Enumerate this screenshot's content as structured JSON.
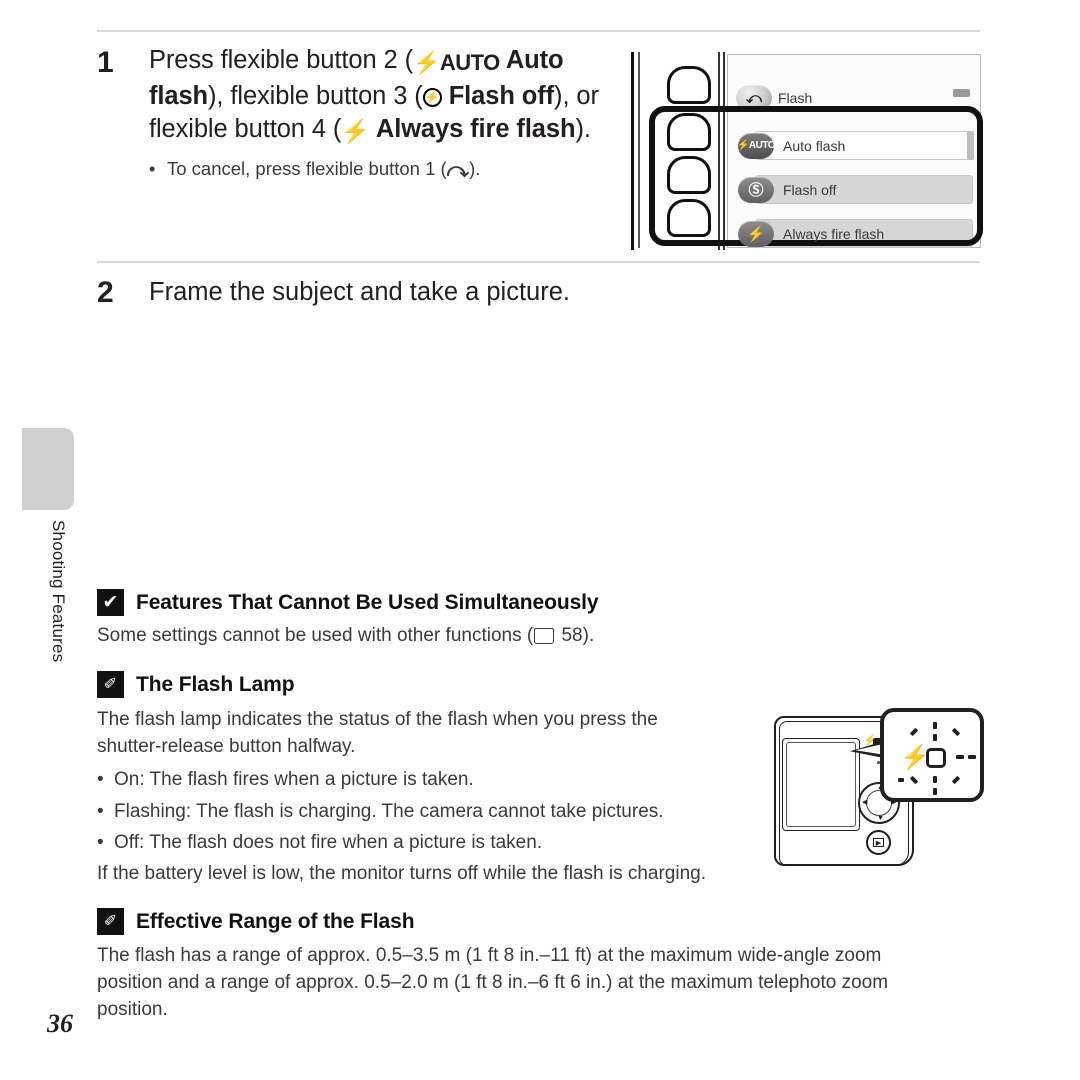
{
  "page": {
    "number": "36",
    "side_tab_label": "Shooting Features"
  },
  "steps": [
    {
      "number": "1",
      "title_parts": [
        {
          "t": "Press flexible button 2 (",
          "bold": false
        },
        {
          "t": "AUTO-FLASH-ICON",
          "icon": true
        },
        {
          "t": " Auto flash",
          "bold": true
        },
        {
          "t": "), flexible button 3 (",
          "bold": false
        },
        {
          "t": "FLASH-OFF-ICON",
          "icon": true
        },
        {
          "t": " Flash off",
          "bold": true
        },
        {
          "t": "), or flexible button 4 (",
          "bold": false
        },
        {
          "t": "ALWAYS-FIRE-ICON",
          "icon": true
        },
        {
          "t": " Always fire flash",
          "bold": true
        },
        {
          "t": ").",
          "bold": false
        }
      ],
      "bullet": "To cancel, press flexible button 1 (",
      "bullet_tail": ")."
    },
    {
      "number": "2",
      "title": "Frame the subject and take a picture."
    }
  ],
  "menu_figure": {
    "screen_title": "Flash",
    "back_icon": "back-arrow-icon",
    "battery_icon": "battery-icon",
    "items": [
      {
        "icon": "auto-flash-icon",
        "icon_label": "AUTO",
        "label": "Auto flash",
        "selected": true
      },
      {
        "icon": "flash-off-icon",
        "icon_label": "",
        "label": "Flash off",
        "selected": false
      },
      {
        "icon": "always-fire-flash-icon",
        "icon_label": "",
        "label": "Always fire flash",
        "selected": false
      }
    ],
    "flexible_buttons": [
      "flexible-button-1",
      "flexible-button-2",
      "flexible-button-3",
      "flexible-button-4"
    ]
  },
  "notes": [
    {
      "badge": "check-icon",
      "badge_glyph": "✔",
      "title": "Features That Cannot Be Used Simultaneously",
      "body_pre": "Some settings cannot be used with other functions (",
      "body_post": " 58)."
    },
    {
      "badge": "pencil-icon",
      "badge_glyph": "✐",
      "title": "The Flash Lamp",
      "para": "The flash lamp indicates the status of the flash when you press the shutter-release button halfway.",
      "bullets": [
        "On: The flash fires when a picture is taken.",
        "Flashing: The flash is charging. The camera cannot take pictures.",
        "Off: The flash does not fire when a picture is taken."
      ],
      "closing": "If the battery level is low, the monitor turns off while the flash is charging."
    },
    {
      "badge": "pencil-icon",
      "badge_glyph": "✐",
      "title": "Effective Range of the Flash",
      "para": "The flash has a range of approx. 0.5–3.5 m (1 ft 8 in.–11 ft) at the maximum wide-angle zoom position and a range of approx. 0.5–2.0 m (1 ft 8 in.–6 ft 6 in.) at the maximum telephoto zoom position."
    }
  ],
  "camera_figure": {
    "lamp_indicator": "flash-lamp-indicator",
    "callout": "flash-lamp-callout",
    "dpad": "multi-selector-dpad",
    "play_button": "playback-button"
  },
  "colors": {
    "text": "#231f20",
    "body_text": "#3a3a3a",
    "rule": "#d8d8d8",
    "tab": "#cfcfcf",
    "badge": "#111111"
  }
}
